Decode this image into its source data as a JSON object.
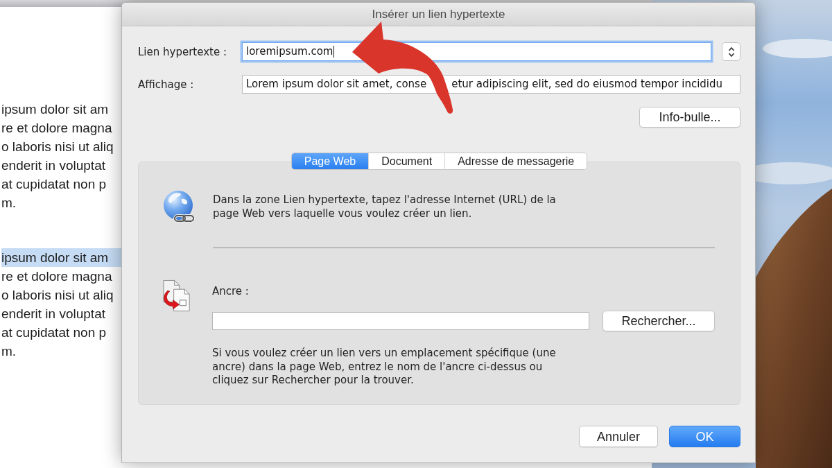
{
  "document": {
    "paragraphs": [
      {
        "lines": [
          {
            "text": "ipsum dolor sit am",
            "highlighted": false
          },
          {
            "text": "re et dolore magna",
            "highlighted": false
          },
          {
            "text": "o laboris nisi ut aliq",
            "highlighted": false
          },
          {
            "text": "enderit in voluptat",
            "highlighted": false
          },
          {
            "text": "at cupidatat non p",
            "highlighted": false
          },
          {
            "text": "m.",
            "highlighted": false
          }
        ]
      },
      {
        "lines": [
          {
            "text": "ipsum dolor sit am",
            "highlighted": true
          },
          {
            "text": "re et dolore magna",
            "highlighted": false
          },
          {
            "text": "o laboris nisi ut aliq",
            "highlighted": false
          },
          {
            "text": "enderit in voluptat",
            "highlighted": false
          },
          {
            "text": "at cupidatat non p",
            "highlighted": false
          },
          {
            "text": "m.",
            "highlighted": false
          }
        ]
      }
    ]
  },
  "dialog": {
    "title": "Insérer un lien hypertexte",
    "fields": [
      {
        "kind": "combo",
        "label": "Lien hypertexte :",
        "value": "loremipsum.com",
        "focused": true
      },
      {
        "kind": "text",
        "label": "Affichage :",
        "value_parts": [
          "Lorem ipsum dolor sit amet, conse",
          "etur adipiscing elit, sed do eiusmod tempor incididu"
        ],
        "focused": false
      }
    ],
    "tooltip_button": "Info-bulle...",
    "tabs": [
      {
        "label": "Page Web",
        "selected": true
      },
      {
        "label": "Document",
        "selected": false
      },
      {
        "label": "Adresse de messagerie",
        "selected": false
      }
    ],
    "panel": {
      "intro": "Dans la zone Lien hypertexte, tapez l'adresse Internet (URL) de la page Web vers laquelle vous voulez créer un lien.",
      "anchor_label": "Ancre :",
      "search_button": "Rechercher...",
      "help": "Si vous voulez créer un lien vers un emplacement spécifique (une ancre) dans la page Web, entrez le nom de l'ancre ci-dessus ou cliquez sur Rechercher pour la trouver."
    },
    "buttons": [
      {
        "label": "Annuler",
        "kind": "default"
      },
      {
        "label": "OK",
        "kind": "primary"
      }
    ]
  }
}
